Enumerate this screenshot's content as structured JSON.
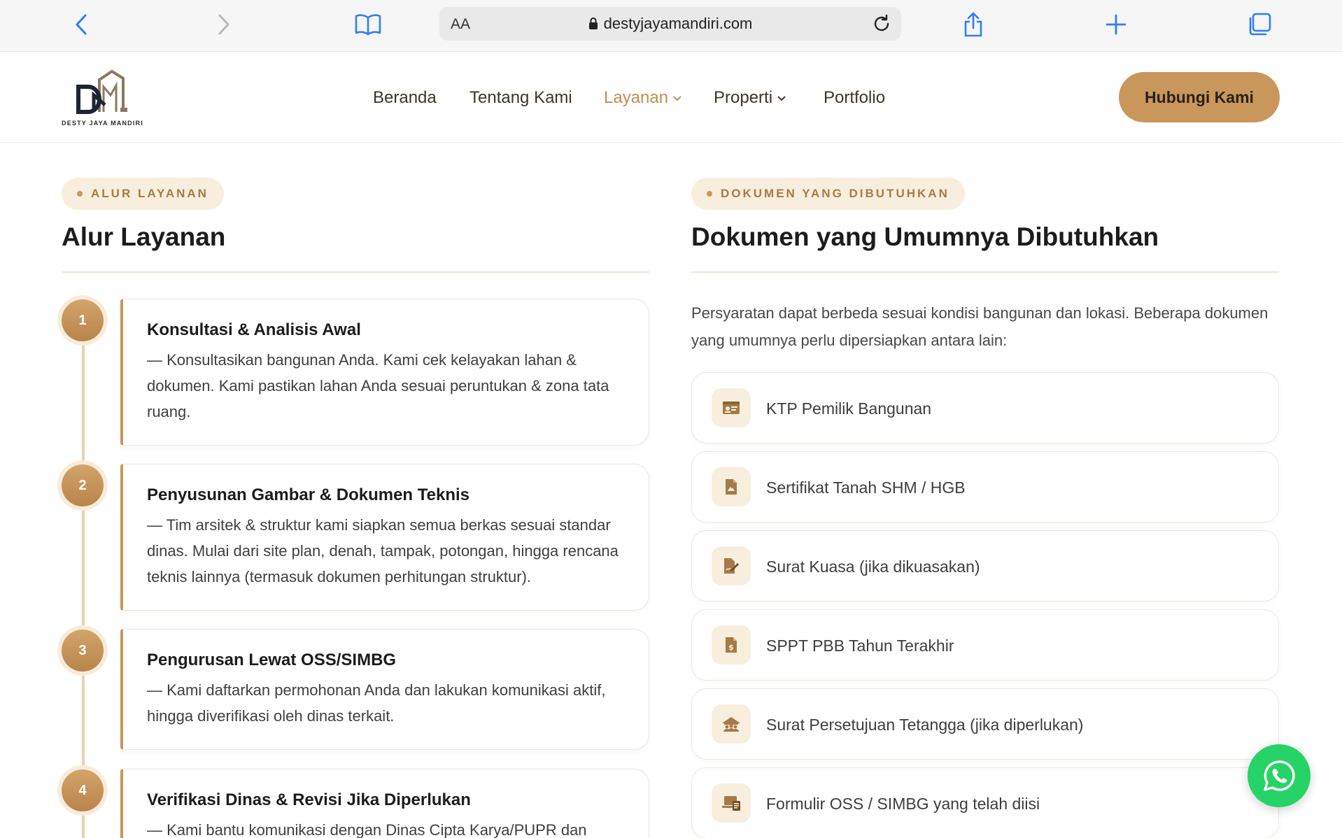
{
  "browser": {
    "text_size_label": "AA",
    "url": "destyjayamandiri.com"
  },
  "header": {
    "logo_text": "DESTY JAYA MANDIRI",
    "nav": [
      {
        "label": "Beranda"
      },
      {
        "label": "Tentang Kami"
      },
      {
        "label": "Layanan",
        "active": true,
        "dropdown": true
      },
      {
        "label": "Properti",
        "dropdown": true
      },
      {
        "label": "Portfolio"
      }
    ],
    "cta_label": "Hubungi Kami"
  },
  "alur": {
    "badge": "ALUR LAYANAN",
    "title": "Alur Layanan",
    "steps": [
      {
        "number": "1",
        "title": "Konsultasi & Analisis Awal",
        "desc": "— Konsultasikan bangunan Anda. Kami cek kelayakan lahan & dokumen. Kami pastikan lahan Anda sesuai peruntukan & zona tata ruang."
      },
      {
        "number": "2",
        "title": "Penyusunan Gambar & Dokumen Teknis",
        "desc": "— Tim arsitek & struktur kami siapkan semua berkas sesuai standar dinas. Mulai dari site plan, denah, tampak, potongan, hingga rencana teknis lainnya (termasuk dokumen perhitungan struktur)."
      },
      {
        "number": "3",
        "title": "Pengurusan Lewat OSS/SIMBG",
        "desc": "— Kami daftarkan permohonan Anda dan lakukan komunikasi aktif, hingga diverifikasi oleh dinas terkait."
      },
      {
        "number": "4",
        "title": "Verifikasi Dinas & Revisi Jika Diperlukan",
        "desc": "— Kami bantu komunikasi dengan Dinas Cipta Karya/PUPR dan"
      }
    ]
  },
  "dokumen": {
    "badge": "DOKUMEN YANG DIBUTUHKAN",
    "title": "Dokumen yang Umumnya Dibutuhkan",
    "intro": "Persyaratan dapat berbeda sesuai kondisi bangunan dan lokasi. Beberapa dokumen yang umumnya perlu dipersiapkan antara lain:",
    "items": [
      {
        "label": "KTP Pemilik Bangunan",
        "icon": "id-card-icon"
      },
      {
        "label": "Sertifikat Tanah SHM / HGB",
        "icon": "file-document-icon"
      },
      {
        "label": "Surat Kuasa (jika dikuasakan)",
        "icon": "file-signature-icon"
      },
      {
        "label": "SPPT PBB Tahun Terakhir",
        "icon": "file-invoice-icon"
      },
      {
        "label": "Surat Persetujuan Tetangga (jika diperlukan)",
        "icon": "neighbors-icon"
      },
      {
        "label": "Formulir OSS / SIMBG yang telah diisi",
        "icon": "form-online-icon"
      }
    ]
  },
  "colors": {
    "accent": "#c9975b",
    "badge_bg": "#f8eedd",
    "whatsapp": "#25d366"
  }
}
